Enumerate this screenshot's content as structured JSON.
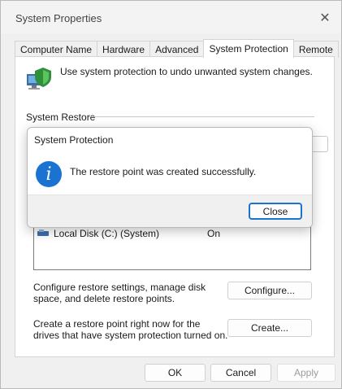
{
  "window": {
    "title": "System Properties"
  },
  "tabs": [
    {
      "label": "Computer Name"
    },
    {
      "label": "Hardware"
    },
    {
      "label": "Advanced"
    },
    {
      "label": "System Protection",
      "active": true
    },
    {
      "label": "Remote"
    }
  ],
  "protection": {
    "description": "Use system protection to undo unwanted system changes.",
    "system_restore_label": "System Restore"
  },
  "drives": [
    {
      "name": "Local Disk (C:) (System)",
      "protection": "On"
    }
  ],
  "configure": {
    "text": "Configure restore settings, manage disk space, and delete restore points.",
    "button": "Configure..."
  },
  "create": {
    "text": "Create a restore point right now for the drives that have system protection turned on.",
    "button": "Create..."
  },
  "footer": {
    "ok": "OK",
    "cancel": "Cancel",
    "apply": "Apply"
  },
  "dialog": {
    "title": "System Protection",
    "message": "The restore point was created successfully.",
    "close_button": "Close",
    "icon": "info-icon"
  },
  "colors": {
    "accent": "#1b73d1"
  }
}
